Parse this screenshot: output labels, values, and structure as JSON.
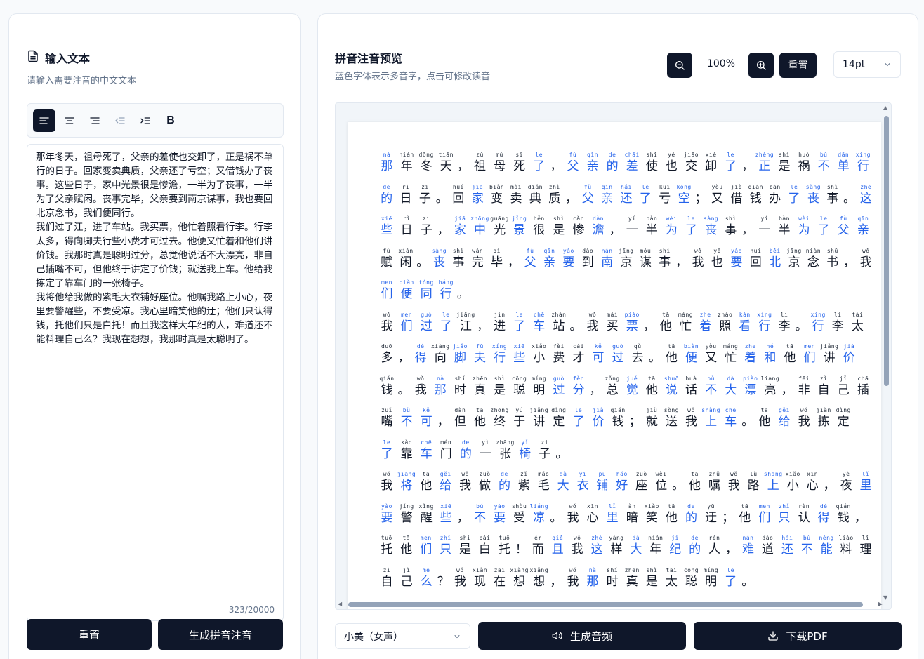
{
  "left_panel": {
    "title": "输入文本",
    "subtitle": "请输入需要注音的中文文本",
    "toolbar": {
      "bold_label": "B"
    },
    "text": "那年冬天，祖母死了，父亲的差使也交卸了，正是祸不单行的日子。回家变卖典质，父亲还了亏空；又借钱办了丧事。这些日子，家中光景很是惨澹，一半为了丧事，一半为了父亲赋闲。丧事完毕，父亲要到南京谋事，我也要回北京念书，我们便同行。\n我们过了江，进了车站。我买票，他忙着照看行李。行李太多，得向脚夫行些小费才可过去。他便又忙着和他们讲价钱。我那时真是聪明过分，总觉他说话不大漂亮，非自己插嘴不可，但他终于讲定了价钱；就送我上车。他给我拣定了靠车门的一张椅子。\n我将他给我做的紫毛大衣铺好座位。他嘱我路上小心，夜里要警醒些，不要受凉。我心里暗笑他的迂；他们只认得钱，托他们只是白托！而且我这样大年纪的人，难道还不能料理自己么？我现在想想，我那时真是太聪明了。",
    "char_count": "323/20000",
    "reset_label": "重置",
    "generate_label": "生成拼音注音"
  },
  "right_panel": {
    "title": "拼音注音预览",
    "subtitle": "蓝色字体表示多音字，点击可修改读音",
    "zoom_level": "100%",
    "reset_label": "重置",
    "font_size": "14pt",
    "voice": "小美（女声）",
    "audio_label": "生成音频",
    "pdf_label": "下载PDF"
  },
  "colors": {
    "polyphonic": "#2563eb",
    "dark": "#0f172a"
  },
  "preview_lines": [
    [
      [
        "nà",
        "那",
        1
      ],
      [
        "nián",
        "年",
        0
      ],
      [
        "dōng",
        "冬",
        0
      ],
      [
        "tiān",
        "天",
        0
      ],
      [
        "",
        "，",
        0
      ],
      [
        "zǔ",
        "祖",
        0
      ],
      [
        "mǔ",
        "母",
        0
      ],
      [
        "sǐ",
        "死",
        0
      ],
      [
        "le",
        "了",
        1
      ],
      [
        "",
        "，",
        0
      ],
      [
        "fù",
        "父",
        1
      ],
      [
        "qīn",
        "亲",
        1
      ],
      [
        "de",
        "的",
        1
      ],
      [
        "chāi",
        "差",
        1
      ],
      [
        "shǐ",
        "使",
        0
      ],
      [
        "yě",
        "也",
        0
      ],
      [
        "jiāo",
        "交",
        0
      ],
      [
        "xiè",
        "卸",
        0
      ],
      [
        "le",
        "了",
        1
      ],
      [
        "",
        "，",
        0
      ],
      [
        "zhèng",
        "正",
        1
      ],
      [
        "shì",
        "是",
        0
      ],
      [
        "huò",
        "祸",
        0
      ],
      [
        "bù",
        "不",
        1
      ],
      [
        "dān",
        "单",
        1
      ],
      [
        "xíng",
        "行",
        1
      ]
    ],
    [
      [
        "de",
        "的",
        1
      ],
      [
        "rì",
        "日",
        0
      ],
      [
        "zi",
        "子",
        0
      ],
      [
        "",
        "。",
        0
      ],
      [
        "huí",
        "回",
        0
      ],
      [
        "jiā",
        "家",
        1
      ],
      [
        "biàn",
        "变",
        0
      ],
      [
        "mài",
        "卖",
        0
      ],
      [
        "diǎn",
        "典",
        0
      ],
      [
        "zhì",
        "质",
        0
      ],
      [
        "",
        "，",
        0
      ],
      [
        "fù",
        "父",
        1
      ],
      [
        "qīn",
        "亲",
        1
      ],
      [
        "hái",
        "还",
        1
      ],
      [
        "le",
        "了",
        1
      ],
      [
        "kuī",
        "亏",
        0
      ],
      [
        "kōng",
        "空",
        1
      ],
      [
        "",
        "；",
        0
      ],
      [
        "yòu",
        "又",
        0
      ],
      [
        "jiè",
        "借",
        0
      ],
      [
        "qián",
        "钱",
        0
      ],
      [
        "bàn",
        "办",
        0
      ],
      [
        "le",
        "了",
        1
      ],
      [
        "sàng",
        "丧",
        1
      ],
      [
        "shì",
        "事",
        0
      ],
      [
        "",
        "。",
        0
      ],
      [
        "zhè",
        "这",
        1
      ]
    ],
    [
      [
        "xiē",
        "些",
        1
      ],
      [
        "rì",
        "日",
        0
      ],
      [
        "zi",
        "子",
        0
      ],
      [
        "",
        "，",
        0
      ],
      [
        "jiā",
        "家",
        1
      ],
      [
        "zhōng",
        "中",
        1
      ],
      [
        "guāng",
        "光",
        0
      ],
      [
        "jǐng",
        "景",
        1
      ],
      [
        "hěn",
        "很",
        0
      ],
      [
        "shì",
        "是",
        0
      ],
      [
        "cǎn",
        "惨",
        0
      ],
      [
        "dàn",
        "澹",
        1
      ],
      [
        "",
        "，",
        0
      ],
      [
        "yí",
        "一",
        0
      ],
      [
        "bàn",
        "半",
        0
      ],
      [
        "wèi",
        "为",
        1
      ],
      [
        "le",
        "了",
        1
      ],
      [
        "sàng",
        "丧",
        1
      ],
      [
        "shì",
        "事",
        0
      ],
      [
        "",
        "，",
        0
      ],
      [
        "yí",
        "一",
        0
      ],
      [
        "bàn",
        "半",
        0
      ],
      [
        "wèi",
        "为",
        1
      ],
      [
        "le",
        "了",
        1
      ],
      [
        "fù",
        "父",
        1
      ],
      [
        "qīn",
        "亲",
        1
      ]
    ],
    [
      [
        "fù",
        "赋",
        0
      ],
      [
        "xián",
        "闲",
        0
      ],
      [
        "",
        "。",
        0
      ],
      [
        "sàng",
        "丧",
        1
      ],
      [
        "shì",
        "事",
        0
      ],
      [
        "wán",
        "完",
        0
      ],
      [
        "bì",
        "毕",
        0
      ],
      [
        "",
        "，",
        0
      ],
      [
        "fù",
        "父",
        1
      ],
      [
        "qīn",
        "亲",
        1
      ],
      [
        "yào",
        "要",
        1
      ],
      [
        "dào",
        "到",
        0
      ],
      [
        "nán",
        "南",
        1
      ],
      [
        "jīng",
        "京",
        0
      ],
      [
        "móu",
        "谋",
        0
      ],
      [
        "shì",
        "事",
        0
      ],
      [
        "",
        "，",
        0
      ],
      [
        "wǒ",
        "我",
        0
      ],
      [
        "yě",
        "也",
        0
      ],
      [
        "yào",
        "要",
        1
      ],
      [
        "huí",
        "回",
        0
      ],
      [
        "běi",
        "北",
        1
      ],
      [
        "jīng",
        "京",
        0
      ],
      [
        "niàn",
        "念",
        0
      ],
      [
        "shū",
        "书",
        0
      ],
      [
        "",
        "，",
        0
      ],
      [
        "wǒ",
        "我",
        0
      ]
    ],
    [
      [
        "men",
        "们",
        1
      ],
      [
        "biàn",
        "便",
        1
      ],
      [
        "tóng",
        "同",
        1
      ],
      [
        "háng",
        "行",
        1
      ],
      [
        "",
        "。",
        0
      ]
    ],
    [
      [
        "wǒ",
        "我",
        0
      ],
      [
        "men",
        "们",
        1
      ],
      [
        "guò",
        "过",
        1
      ],
      [
        "le",
        "了",
        1
      ],
      [
        "jiāng",
        "江",
        0
      ],
      [
        "",
        "，",
        0
      ],
      [
        "jìn",
        "进",
        0
      ],
      [
        "le",
        "了",
        1
      ],
      [
        "chē",
        "车",
        1
      ],
      [
        "zhàn",
        "站",
        0
      ],
      [
        "",
        "。",
        0
      ],
      [
        "wǒ",
        "我",
        0
      ],
      [
        "mǎi",
        "买",
        0
      ],
      [
        "piào",
        "票",
        1
      ],
      [
        "",
        "，",
        0
      ],
      [
        "tā",
        "他",
        0
      ],
      [
        "máng",
        "忙",
        0
      ],
      [
        "zhe",
        "着",
        1
      ],
      [
        "zhào",
        "照",
        0
      ],
      [
        "kàn",
        "看",
        1
      ],
      [
        "xíng",
        "行",
        1
      ],
      [
        "li",
        "李",
        0
      ],
      [
        "",
        "。",
        0
      ],
      [
        "xíng",
        "行",
        1
      ],
      [
        "li",
        "李",
        0
      ],
      [
        "tài",
        "太",
        0
      ]
    ],
    [
      [
        "duō",
        "多",
        0
      ],
      [
        "",
        "，",
        0
      ],
      [
        "dé",
        "得",
        1
      ],
      [
        "xiàng",
        "向",
        0
      ],
      [
        "jiǎo",
        "脚",
        1
      ],
      [
        "fū",
        "夫",
        1
      ],
      [
        "xíng",
        "行",
        1
      ],
      [
        "xiē",
        "些",
        1
      ],
      [
        "xiǎo",
        "小",
        0
      ],
      [
        "fèi",
        "费",
        0
      ],
      [
        "cái",
        "才",
        0
      ],
      [
        "kě",
        "可",
        1
      ],
      [
        "guò",
        "过",
        1
      ],
      [
        "qù",
        "去",
        0
      ],
      [
        "",
        "。",
        0
      ],
      [
        "tā",
        "他",
        0
      ],
      [
        "biàn",
        "便",
        1
      ],
      [
        "yòu",
        "又",
        0
      ],
      [
        "máng",
        "忙",
        0
      ],
      [
        "zhe",
        "着",
        1
      ],
      [
        "hé",
        "和",
        1
      ],
      [
        "tā",
        "他",
        0
      ],
      [
        "men",
        "们",
        1
      ],
      [
        "jiǎng",
        "讲",
        0
      ],
      [
        "jià",
        "价",
        1
      ]
    ],
    [
      [
        "qián",
        "钱",
        0
      ],
      [
        "",
        "。",
        0
      ],
      [
        "wǒ",
        "我",
        0
      ],
      [
        "nà",
        "那",
        1
      ],
      [
        "shí",
        "时",
        0
      ],
      [
        "zhēn",
        "真",
        0
      ],
      [
        "shì",
        "是",
        0
      ],
      [
        "cōng",
        "聪",
        0
      ],
      [
        "míng",
        "明",
        0
      ],
      [
        "guò",
        "过",
        1
      ],
      [
        "fèn",
        "分",
        1
      ],
      [
        "",
        "，",
        0
      ],
      [
        "zǒng",
        "总",
        0
      ],
      [
        "jué",
        "觉",
        1
      ],
      [
        "tā",
        "他",
        0
      ],
      [
        "shuō",
        "说",
        1
      ],
      [
        "huà",
        "话",
        0
      ],
      [
        "bù",
        "不",
        1
      ],
      [
        "dà",
        "大",
        1
      ],
      [
        "piào",
        "漂",
        1
      ],
      [
        "liang",
        "亮",
        0
      ],
      [
        "",
        "，",
        0
      ],
      [
        "fēi",
        "非",
        0
      ],
      [
        "zì",
        "自",
        0
      ],
      [
        "jǐ",
        "己",
        0
      ],
      [
        "chā",
        "插",
        0
      ]
    ],
    [
      [
        "zuǐ",
        "嘴",
        0
      ],
      [
        "bù",
        "不",
        1
      ],
      [
        "kě",
        "可",
        1
      ],
      [
        "",
        "，",
        0
      ],
      [
        "dàn",
        "但",
        0
      ],
      [
        "tā",
        "他",
        0
      ],
      [
        "zhōng",
        "终",
        0
      ],
      [
        "yú",
        "于",
        0
      ],
      [
        "jiǎng",
        "讲",
        0
      ],
      [
        "dìng",
        "定",
        0
      ],
      [
        "le",
        "了",
        1
      ],
      [
        "jià",
        "价",
        1
      ],
      [
        "qián",
        "钱",
        0
      ],
      [
        "",
        "；",
        0
      ],
      [
        "jiù",
        "就",
        0
      ],
      [
        "sòng",
        "送",
        0
      ],
      [
        "wǒ",
        "我",
        0
      ],
      [
        "shàng",
        "上",
        1
      ],
      [
        "chē",
        "车",
        1
      ],
      [
        "",
        "。",
        0
      ],
      [
        "tā",
        "他",
        0
      ],
      [
        "gěi",
        "给",
        1
      ],
      [
        "wǒ",
        "我",
        0
      ],
      [
        "jiǎn",
        "拣",
        0
      ],
      [
        "dìng",
        "定",
        0
      ]
    ],
    [
      [
        "le",
        "了",
        1
      ],
      [
        "kào",
        "靠",
        0
      ],
      [
        "chē",
        "车",
        1
      ],
      [
        "mén",
        "门",
        0
      ],
      [
        "de",
        "的",
        1
      ],
      [
        "yì",
        "一",
        0
      ],
      [
        "zhāng",
        "张",
        0
      ],
      [
        "yǐ",
        "椅",
        1
      ],
      [
        "zi",
        "子",
        0
      ],
      [
        "",
        "。",
        0
      ]
    ],
    [
      [
        "wǒ",
        "我",
        0
      ],
      [
        "jiāng",
        "将",
        1
      ],
      [
        "tā",
        "他",
        0
      ],
      [
        "gěi",
        "给",
        1
      ],
      [
        "wǒ",
        "我",
        0
      ],
      [
        "zuò",
        "做",
        0
      ],
      [
        "de",
        "的",
        1
      ],
      [
        "zǐ",
        "紫",
        0
      ],
      [
        "máo",
        "毛",
        0
      ],
      [
        "dà",
        "大",
        1
      ],
      [
        "yī",
        "衣",
        1
      ],
      [
        "pū",
        "铺",
        1
      ],
      [
        "hǎo",
        "好",
        1
      ],
      [
        "zuò",
        "座",
        0
      ],
      [
        "wèi",
        "位",
        0
      ],
      [
        "",
        "。",
        0
      ],
      [
        "tā",
        "他",
        0
      ],
      [
        "zhǔ",
        "嘱",
        0
      ],
      [
        "wǒ",
        "我",
        0
      ],
      [
        "lù",
        "路",
        0
      ],
      [
        "shang",
        "上",
        1
      ],
      [
        "xiǎo",
        "小",
        0
      ],
      [
        "xīn",
        "心",
        0
      ],
      [
        "",
        "，",
        0
      ],
      [
        "yè",
        "夜",
        0
      ],
      [
        "lǐ",
        "里",
        1
      ]
    ],
    [
      [
        "yào",
        "要",
        1
      ],
      [
        "jǐng",
        "警",
        0
      ],
      [
        "xǐng",
        "醒",
        0
      ],
      [
        "xiē",
        "些",
        1
      ],
      [
        "",
        "，",
        0
      ],
      [
        "bú",
        "不",
        1
      ],
      [
        "yào",
        "要",
        1
      ],
      [
        "shòu",
        "受",
        0
      ],
      [
        "liáng",
        "凉",
        1
      ],
      [
        "",
        "。",
        0
      ],
      [
        "wǒ",
        "我",
        0
      ],
      [
        "xīn",
        "心",
        0
      ],
      [
        "lǐ",
        "里",
        1
      ],
      [
        "àn",
        "暗",
        0
      ],
      [
        "xiào",
        "笑",
        0
      ],
      [
        "tā",
        "他",
        0
      ],
      [
        "de",
        "的",
        1
      ],
      [
        "yū",
        "迂",
        0
      ],
      [
        "",
        "；",
        0
      ],
      [
        "tā",
        "他",
        0
      ],
      [
        "men",
        "们",
        1
      ],
      [
        "zhǐ",
        "只",
        1
      ],
      [
        "rèn",
        "认",
        0
      ],
      [
        "dé",
        "得",
        1
      ],
      [
        "qián",
        "钱",
        0
      ],
      [
        "",
        "，",
        0
      ]
    ],
    [
      [
        "tuō",
        "托",
        0
      ],
      [
        "tā",
        "他",
        0
      ],
      [
        "men",
        "们",
        1
      ],
      [
        "zhǐ",
        "只",
        1
      ],
      [
        "shì",
        "是",
        0
      ],
      [
        "bái",
        "白",
        0
      ],
      [
        "tuō",
        "托",
        0
      ],
      [
        "",
        "！",
        0
      ],
      [
        "ér",
        "而",
        0
      ],
      [
        "qiě",
        "且",
        1
      ],
      [
        "wǒ",
        "我",
        0
      ],
      [
        "zhè",
        "这",
        1
      ],
      [
        "yàng",
        "样",
        0
      ],
      [
        "dà",
        "大",
        1
      ],
      [
        "nián",
        "年",
        0
      ],
      [
        "jì",
        "纪",
        1
      ],
      [
        "de",
        "的",
        1
      ],
      [
        "rén",
        "人",
        0
      ],
      [
        "",
        "，",
        0
      ],
      [
        "nán",
        "难",
        1
      ],
      [
        "dào",
        "道",
        0
      ],
      [
        "hái",
        "还",
        1
      ],
      [
        "bù",
        "不",
        1
      ],
      [
        "néng",
        "能",
        1
      ],
      [
        "liào",
        "料",
        0
      ],
      [
        "lǐ",
        "理",
        0
      ]
    ],
    [
      [
        "zì",
        "自",
        0
      ],
      [
        "jǐ",
        "己",
        0
      ],
      [
        "me",
        "么",
        1
      ],
      [
        "",
        "？",
        0
      ],
      [
        "wǒ",
        "我",
        0
      ],
      [
        "xiàn",
        "现",
        0
      ],
      [
        "zài",
        "在",
        0
      ],
      [
        "xiǎng",
        "想",
        0
      ],
      [
        "xiǎng",
        "想",
        0
      ],
      [
        "",
        "，",
        0
      ],
      [
        "wǒ",
        "我",
        0
      ],
      [
        "nà",
        "那",
        1
      ],
      [
        "shí",
        "时",
        0
      ],
      [
        "zhēn",
        "真",
        0
      ],
      [
        "shì",
        "是",
        0
      ],
      [
        "tài",
        "太",
        0
      ],
      [
        "cōng",
        "聪",
        0
      ],
      [
        "míng",
        "明",
        0
      ],
      [
        "le",
        "了",
        1
      ],
      [
        "",
        "。",
        0
      ]
    ]
  ]
}
